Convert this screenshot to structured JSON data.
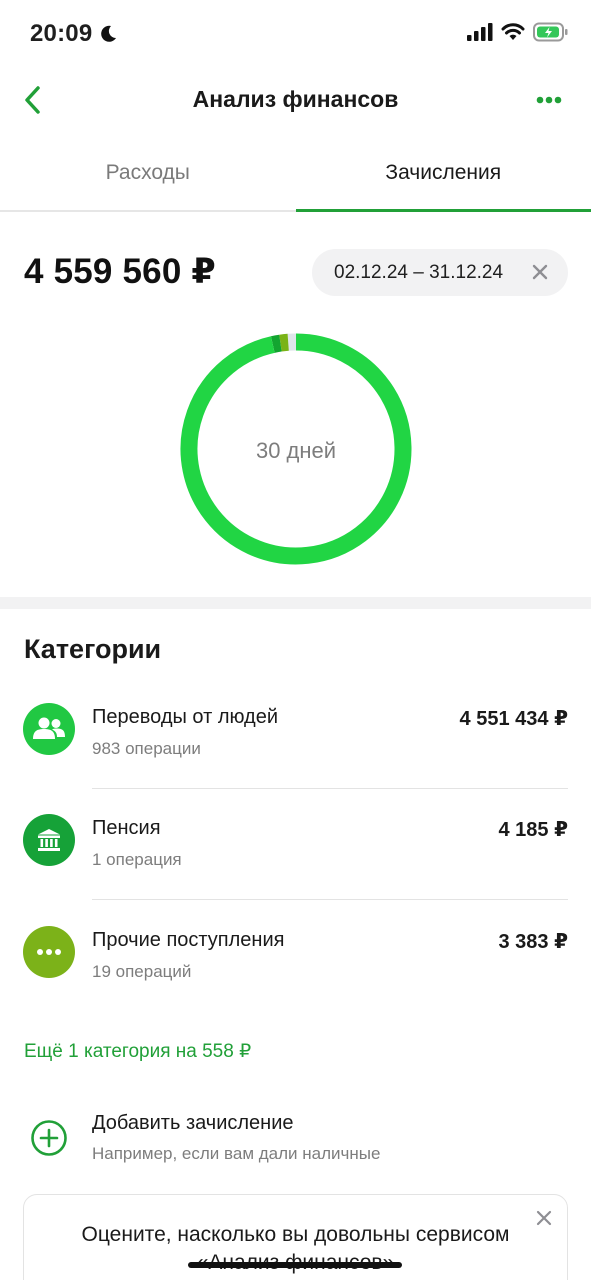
{
  "status_bar": {
    "time": "20:09"
  },
  "nav": {
    "title": "Анализ финансов"
  },
  "tabs": [
    {
      "label": "Расходы",
      "active": false
    },
    {
      "label": "Зачисления",
      "active": true
    }
  ],
  "summary": {
    "total": "4 559 560 ₽",
    "date_range": "02.12.24 – 31.12.24",
    "donut_label": "30 дней"
  },
  "chart_data": {
    "type": "pie",
    "series": [
      {
        "name": "Переводы от людей",
        "value": 4551434,
        "color": "#21d544"
      },
      {
        "name": "Пенсия",
        "value": 4185,
        "color": "#13a530"
      },
      {
        "name": "Прочие поступления",
        "value": 3383,
        "color": "#7ab317"
      },
      {
        "name": "Ещё 1 категория",
        "value": 558,
        "color": "#dfe5ea"
      }
    ]
  },
  "categories": {
    "heading": "Категории",
    "items": [
      {
        "name": "Переводы от людей",
        "count": "983 операции",
        "amount": "4 551 434 ₽",
        "icon": "people-icon",
        "color": "#21c843"
      },
      {
        "name": "Пенсия",
        "count": "1 операция",
        "amount": "4 185 ₽",
        "icon": "bank-icon",
        "color": "#16a238"
      },
      {
        "name": "Прочие поступления",
        "count": "19 операций",
        "amount": "3 383 ₽",
        "icon": "dots-icon",
        "color": "#7cb219"
      }
    ],
    "more_link": "Ещё 1 категория на 558 ₽"
  },
  "add_income": {
    "title": "Добавить зачисление",
    "subtitle": "Например, если вам дали наличные"
  },
  "rating_card": {
    "text": "Оцените, насколько вы довольны сервисом «Анализ финансов»"
  },
  "colors": {
    "accent": "#21a038",
    "chip_bg": "#f2f2f3"
  }
}
